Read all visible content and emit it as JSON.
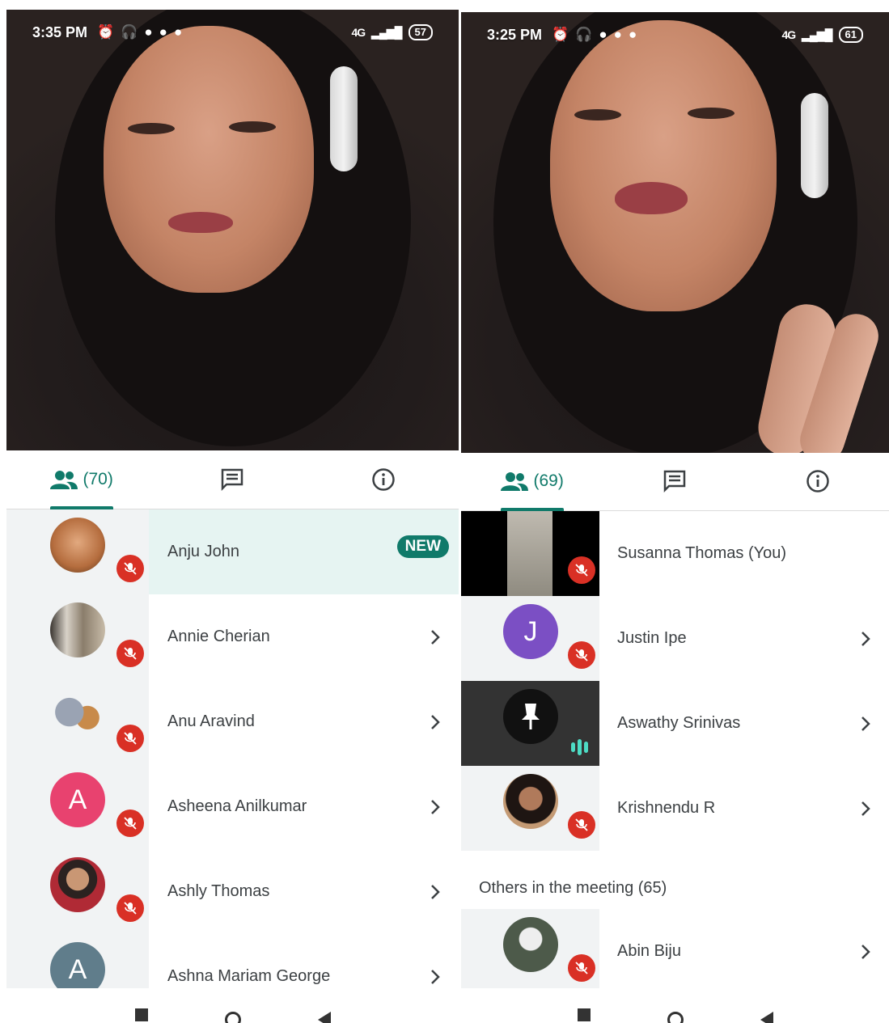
{
  "left_screen": {
    "status": {
      "time": "3:35 PM",
      "battery": "57",
      "network": "4G"
    },
    "tabs": {
      "people_count": "(70)"
    },
    "participants": [
      {
        "name": "Anju John",
        "badge": "NEW",
        "avatar": "photo",
        "color": "#c77e4f"
      },
      {
        "name": "Annie Cherian",
        "avatar": "photo",
        "color": "#8a7d6b"
      },
      {
        "name": "Anu Aravind",
        "avatar": "cartoon",
        "color": "#a7b3c4"
      },
      {
        "name": "Asheena Anilkumar",
        "avatar": "letter",
        "initial": "A",
        "color": "#e8426f"
      },
      {
        "name": "Ashly Thomas",
        "avatar": "photo",
        "color": "#d7c4b0"
      },
      {
        "name": "Ashna Mariam George",
        "avatar": "letter",
        "initial": "A",
        "color": "#607d8b"
      }
    ]
  },
  "right_screen": {
    "status": {
      "time": "3:25 PM",
      "battery": "61",
      "network": "4G"
    },
    "tabs": {
      "people_count": "(69)"
    },
    "pinned": [
      {
        "name": "Susanna Thomas (You)",
        "tile": "video"
      },
      {
        "name": "Justin Ipe",
        "avatar": "letter",
        "initial": "J",
        "color": "#7b4fc4"
      },
      {
        "name": "Aswathy Srinivas",
        "tile": "presenting"
      },
      {
        "name": "Krishnendu R",
        "avatar": "photo",
        "color": "#7a4a36"
      }
    ],
    "others_label": "Others in the meeting (65)",
    "others": [
      {
        "name": "Abin Biju",
        "avatar": "photo",
        "color": "#4d5a4a"
      }
    ]
  }
}
